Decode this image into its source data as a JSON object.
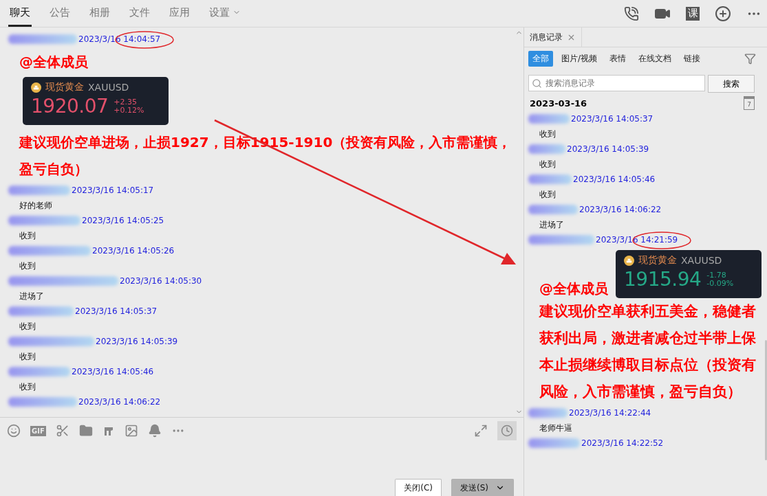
{
  "top_tabs": [
    {
      "label": "聊天",
      "selected": true,
      "has_menu": false
    },
    {
      "label": "公告",
      "selected": false,
      "has_menu": false
    },
    {
      "label": "相册",
      "selected": false,
      "has_menu": false
    },
    {
      "label": "文件",
      "selected": false,
      "has_menu": false
    },
    {
      "label": "应用",
      "selected": false,
      "has_menu": false
    },
    {
      "label": "设置",
      "selected": false,
      "has_menu": true
    }
  ],
  "course_badge": "课",
  "chat": {
    "messages": [
      {
        "kind": "announcement",
        "time": "2023/3/16 14:04:57",
        "circled": true,
        "mention": "@全体成员",
        "quote": {
          "name": "现货黄金",
          "symbol": "XAUUSD",
          "price": "1920.07",
          "change": "+2.35",
          "change_pct": "+0.12%",
          "color": "#e2506a"
        },
        "body": "建议现价空单进场，止损1927，目标1915-1910（投资有风险，入市需谨慎，盈亏自负）"
      },
      {
        "kind": "text",
        "time": "2023/3/16 14:05:17",
        "circled": false,
        "body": "好的老师"
      },
      {
        "kind": "text",
        "time": "2023/3/16 14:05:25",
        "circled": false,
        "body": "收到"
      },
      {
        "kind": "text",
        "time": "2023/3/16 14:05:26",
        "circled": false,
        "body": "收到"
      },
      {
        "kind": "text",
        "time": "2023/3/16 14:05:30",
        "circled": false,
        "body": "进场了"
      },
      {
        "kind": "text",
        "time": "2023/3/16 14:05:37",
        "circled": false,
        "body": "收到"
      },
      {
        "kind": "text",
        "time": "2023/3/16 14:05:39",
        "circled": false,
        "body": "收到"
      },
      {
        "kind": "text",
        "time": "2023/3/16 14:05:46",
        "circled": false,
        "body": "收到"
      },
      {
        "kind": "text",
        "time": "2023/3/16 14:06:22",
        "circled": false
      }
    ]
  },
  "toolbar": {
    "gif_label": "GIF"
  },
  "buttons": {
    "close": "关闭(C)",
    "send": "发送(S)"
  },
  "annotation_arrow": true,
  "history": {
    "tab": "消息记录",
    "filters": [
      {
        "label": "全部",
        "selected": true
      },
      {
        "label": "图片/视频",
        "selected": false
      },
      {
        "label": "表情",
        "selected": false
      },
      {
        "label": "在线文档",
        "selected": false
      },
      {
        "label": "链接",
        "selected": false
      }
    ],
    "search": {
      "placeholder": "搜索消息记录",
      "button": "搜索"
    },
    "date": "2023-03-16",
    "calendar_day": "7",
    "messages": [
      {
        "kind": "text",
        "time": "2023/3/16 14:05:37",
        "circled": false,
        "body": "收到"
      },
      {
        "kind": "text",
        "time": "2023/3/16 14:05:39",
        "circled": false,
        "body": "收到"
      },
      {
        "kind": "text",
        "time": "2023/3/16 14:05:46",
        "circled": false,
        "body": "收到"
      },
      {
        "kind": "text",
        "time": "2023/3/16 14:06:22",
        "circled": false,
        "body": "进场了"
      },
      {
        "kind": "announcement",
        "time": "2023/3/16 14:21:59",
        "circled": true,
        "mention": "@全体成员",
        "quote": {
          "name": "现货黄金",
          "symbol": "XAUUSD",
          "price": "1915.94",
          "change": "-1.78",
          "change_pct": "-0.09%",
          "color": "#25a887"
        },
        "body": "建议现价空单获利五美金，稳健者获利出局，激进者减仓过半带上保本止损继续博取目标点位（投资有风险，入市需谨慎，盈亏自负）"
      },
      {
        "kind": "text",
        "time": "2023/3/16 14:22:44",
        "circled": false,
        "body": "老师牛逼"
      },
      {
        "kind": "text",
        "time": "2023/3/16 14:22:52",
        "circled": false
      }
    ]
  }
}
